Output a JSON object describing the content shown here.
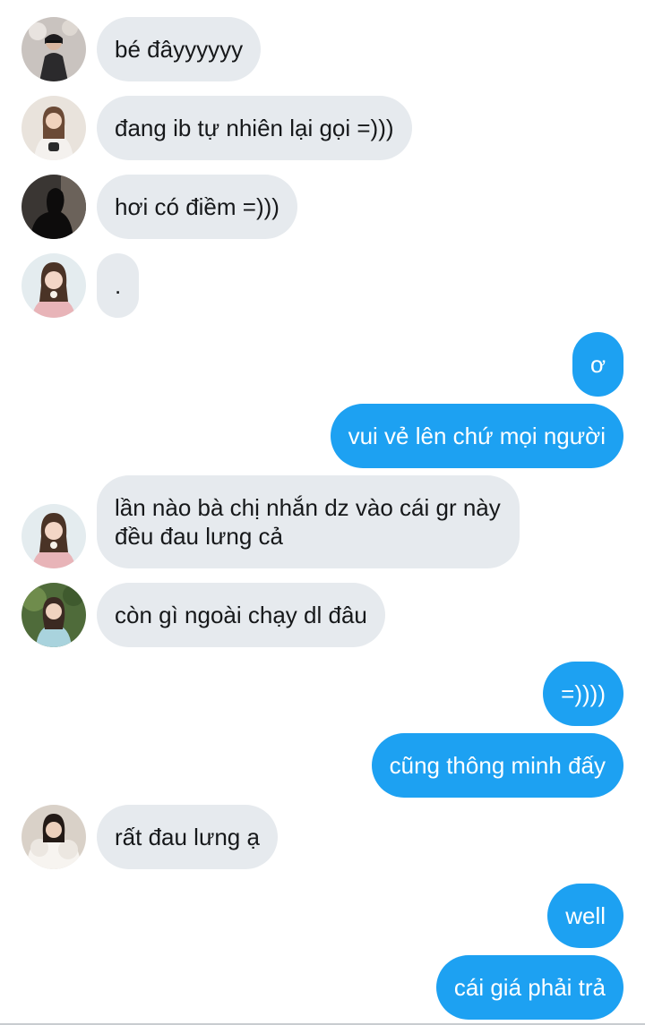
{
  "messages": [
    {
      "direction": "incoming",
      "avatar": "avatar-1",
      "text": "bé đâyyyyyy"
    },
    {
      "direction": "incoming",
      "avatar": "avatar-2",
      "text": "đang ib tự nhiên lại gọi =)))"
    },
    {
      "direction": "incoming",
      "avatar": "avatar-3",
      "text": "hơi có điềm =)))"
    },
    {
      "direction": "incoming",
      "avatar": "avatar-4",
      "text": "."
    },
    {
      "direction": "outgoing",
      "text": "ơ"
    },
    {
      "direction": "outgoing",
      "text": "vui vẻ lên chứ mọi người"
    },
    {
      "direction": "incoming",
      "avatar": "avatar-4",
      "text": "lần nào bà chị nhắn dz vào cái gr này đều đau lưng cả"
    },
    {
      "direction": "incoming",
      "avatar": "avatar-5",
      "text": "còn gì ngoài chạy dl đâu"
    },
    {
      "direction": "outgoing",
      "text": "=))))"
    },
    {
      "direction": "outgoing",
      "text": "cũng thông minh đấy"
    },
    {
      "direction": "incoming",
      "avatar": "avatar-6",
      "text": "rất đau lưng ạ"
    },
    {
      "direction": "outgoing",
      "text": "well"
    },
    {
      "direction": "outgoing",
      "text": "cái giá phải trả"
    }
  ],
  "colors": {
    "incoming_bubble": "#e6eaee",
    "outgoing_bubble": "#1da1f2",
    "incoming_text": "#16181a",
    "outgoing_text": "#ffffff"
  }
}
